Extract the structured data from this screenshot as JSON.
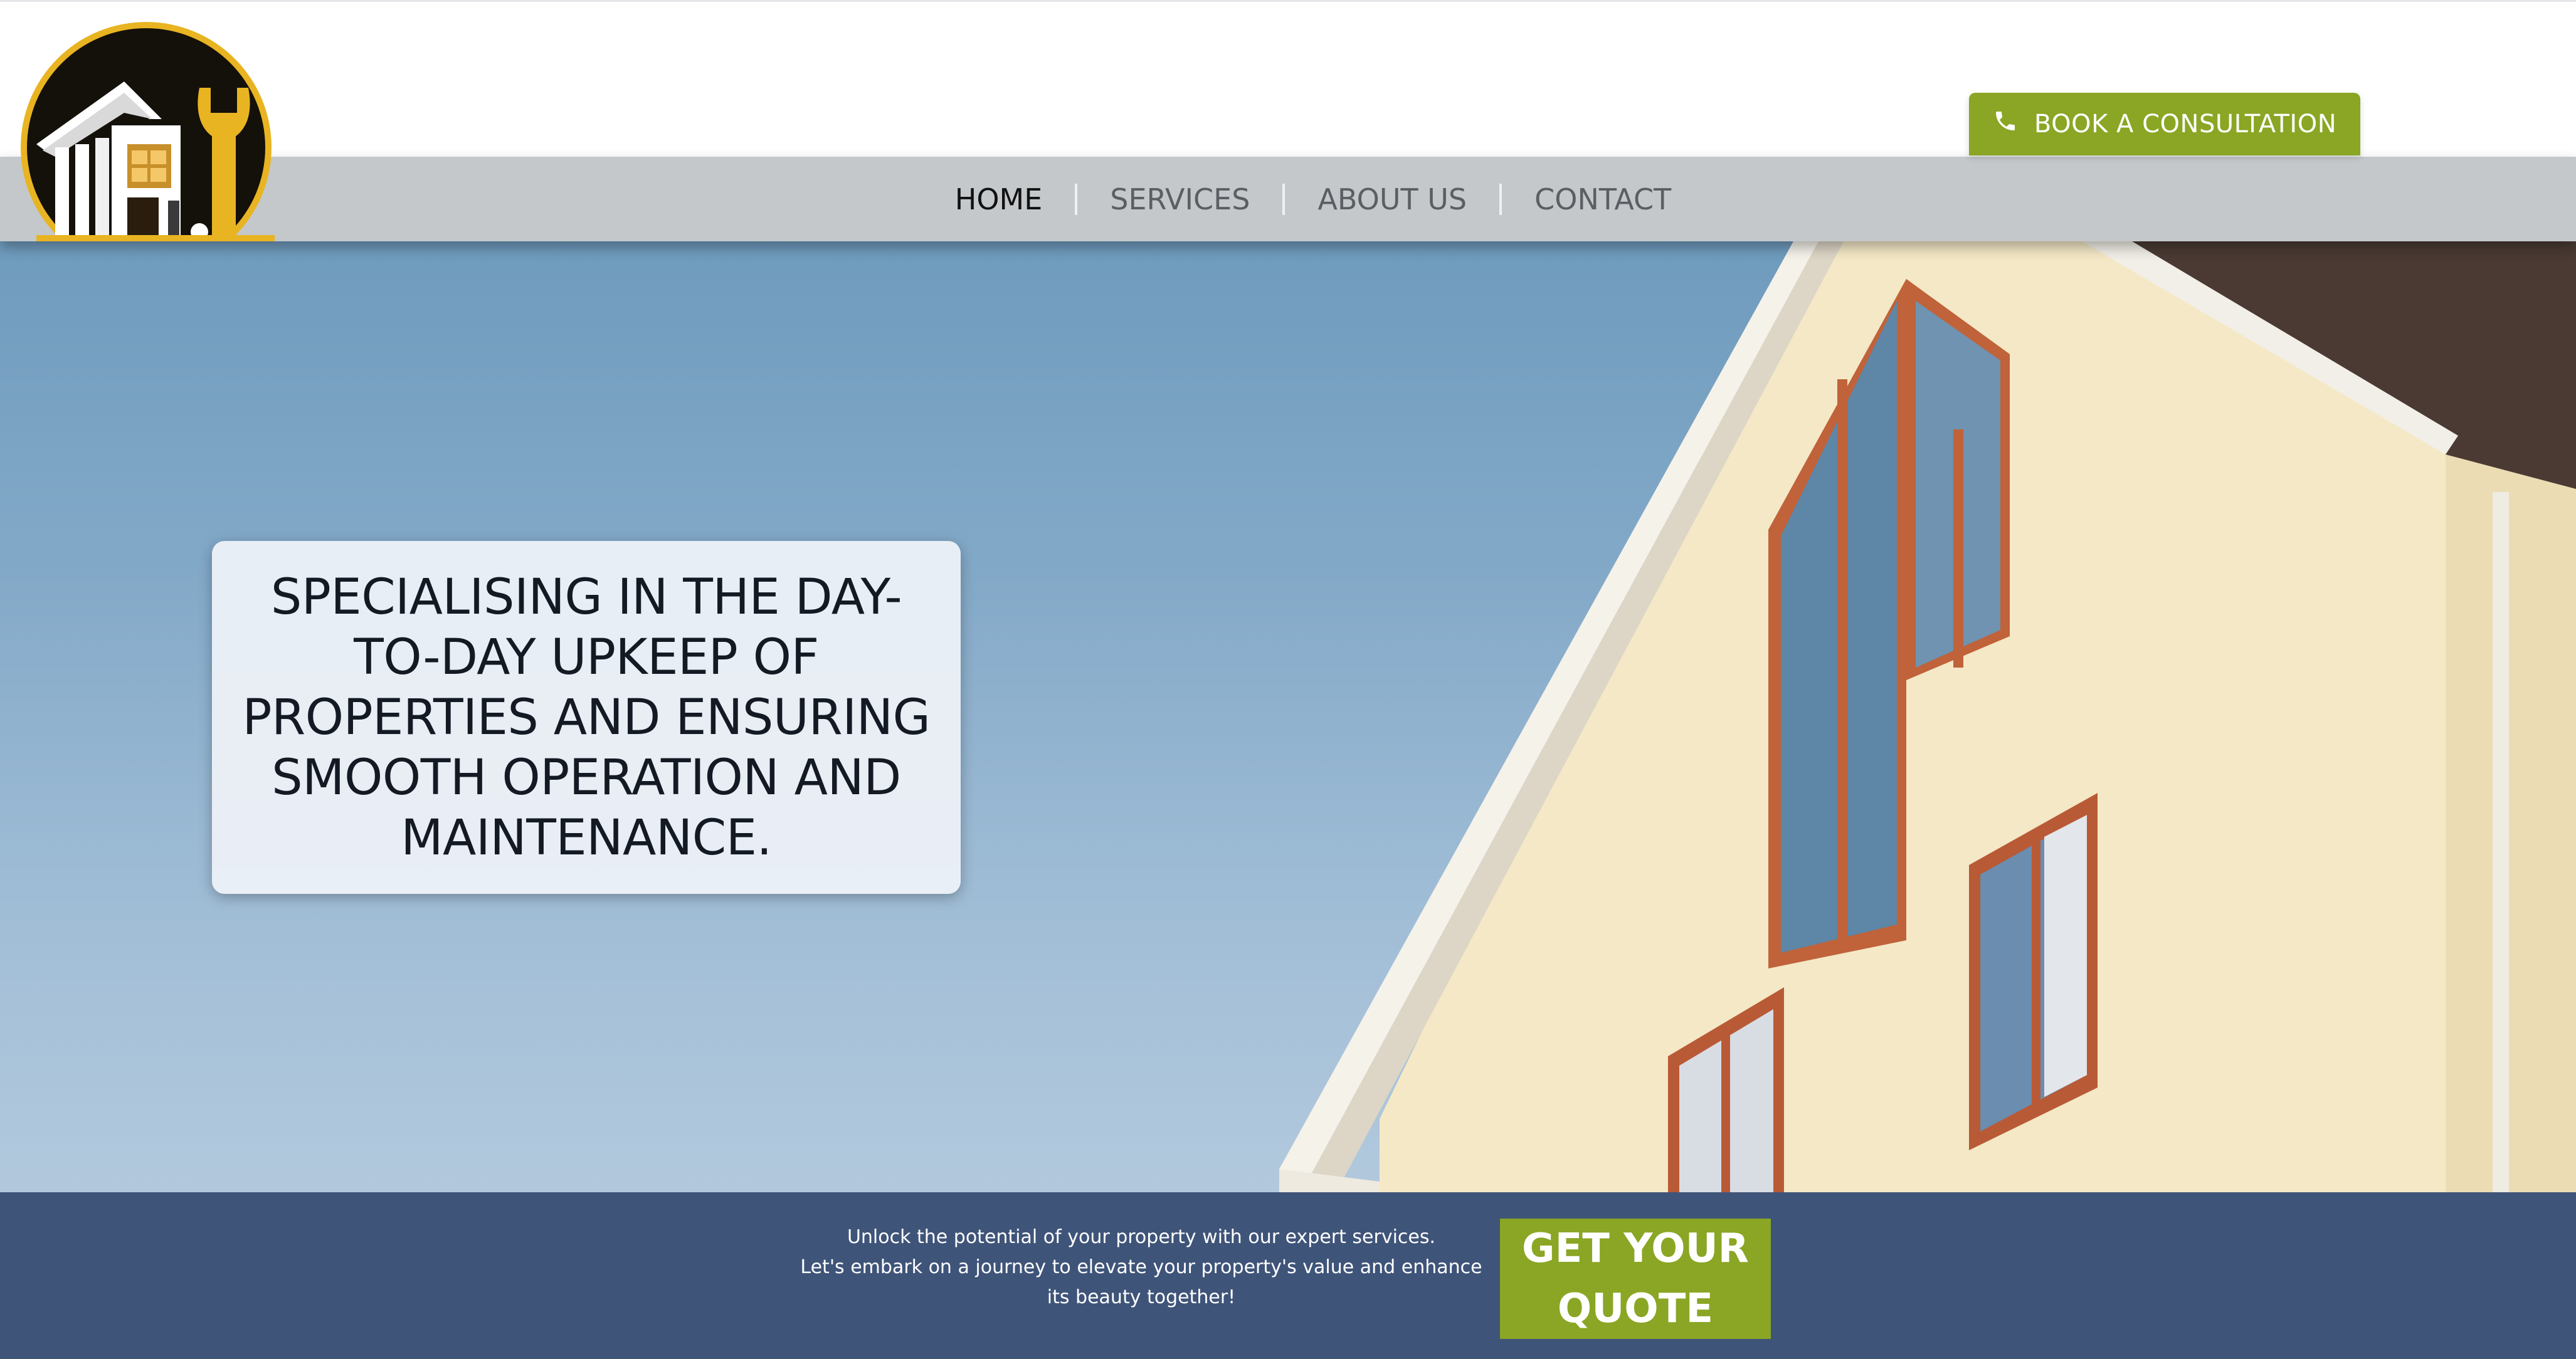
{
  "header": {
    "logo_icon": "house-wrench-logo",
    "book_button": {
      "icon": "phone-icon",
      "label": "BOOK A CONSULTATION"
    }
  },
  "nav": {
    "items": [
      {
        "label": "HOME",
        "active": true
      },
      {
        "label": "SERVICES",
        "active": false
      },
      {
        "label": "ABOUT US",
        "active": false
      },
      {
        "label": "CONTACT",
        "active": false
      }
    ]
  },
  "hero": {
    "tagline_lines": [
      "SPECIALISING IN THE DAY-",
      "TO-DAY UPKEEP OF",
      "PROPERTIES AND ENSURING",
      "SMOOTH OPERATION AND",
      "MAINTENANCE."
    ]
  },
  "footer_cta": {
    "promo_lines": [
      "Unlock the potential of your property with our expert services.",
      "Let's embark on a journey to elevate your property's value and enhance",
      "its beauty together!"
    ],
    "quote_button_lines": [
      "GET YOUR",
      "QUOTE"
    ]
  },
  "colors": {
    "accent_green": "#8aa624",
    "nav_bg": "#c4c8cb",
    "footer_bg": "#3f5479",
    "sky": "#83a9c8",
    "house_wall": "#f4e8c6",
    "window_frame": "#c0623a",
    "logo_gold": "#e8b422"
  }
}
